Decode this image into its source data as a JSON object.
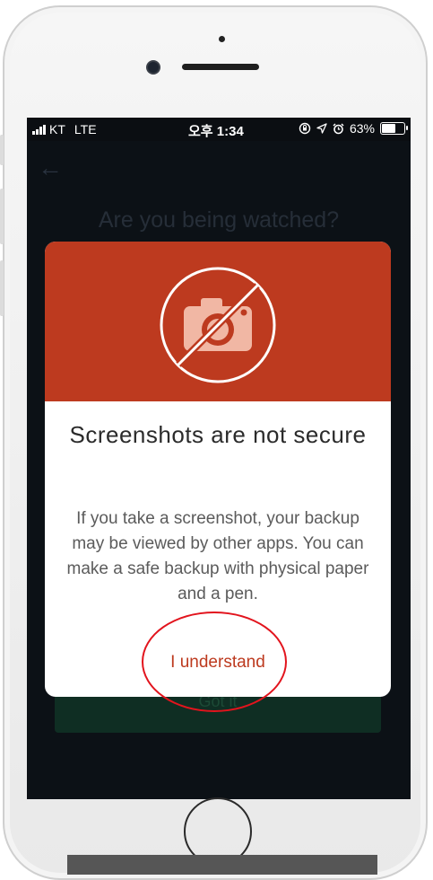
{
  "status_bar": {
    "carrier": "KT",
    "network": "LTE",
    "time": "오후 1:34",
    "battery": "63%",
    "icons": [
      "signal-bars-icon",
      "lock-rotation-icon",
      "location-arrow-icon",
      "alarm-icon",
      "battery-icon"
    ]
  },
  "background_screen": {
    "back_icon": "back-arrow-icon",
    "title": "Are you being watched?",
    "primary_button_label": "Got it"
  },
  "modal": {
    "header_color": "#bd3a1f",
    "icon": "no-camera-icon",
    "title": "Screenshots are not secure",
    "body": "If you take a screenshot, your backup may be viewed by other apps. You can make a safe backup with physical paper and a pen.",
    "action_label": "I understand"
  },
  "colors": {
    "accent": "#bd3a1f",
    "annotation": "#e2141d",
    "screen_background": "#0c1116"
  }
}
